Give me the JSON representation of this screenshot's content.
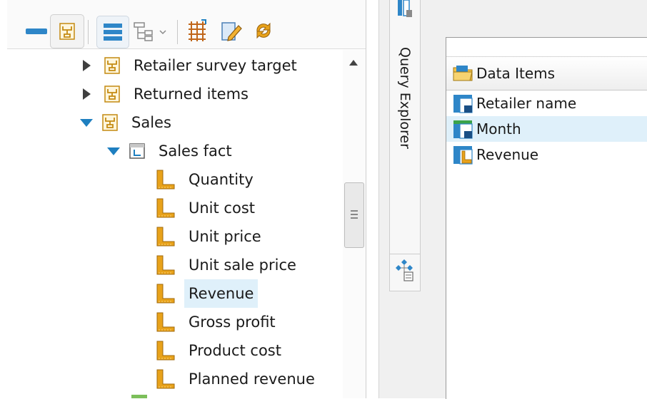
{
  "toolbar": {
    "buttons": [
      "collapse-all-icon",
      "package-view-icon",
      "list-view-icon",
      "tree-view-icon",
      "grid-icon",
      "edit-icon",
      "refresh-icon"
    ]
  },
  "tree": {
    "items": [
      {
        "label": "Retailer survey target",
        "state": "collapsed",
        "icon": "namespace-icon"
      },
      {
        "label": "Returned items",
        "state": "collapsed",
        "icon": "namespace-icon"
      },
      {
        "label": "Sales",
        "state": "expanded",
        "icon": "namespace-icon"
      },
      {
        "label": "Sales fact",
        "state": "expanded",
        "icon": "query-subject-icon"
      },
      {
        "label": "Quantity",
        "icon": "measure-icon"
      },
      {
        "label": "Unit cost",
        "icon": "measure-icon"
      },
      {
        "label": "Unit price",
        "icon": "measure-icon"
      },
      {
        "label": "Unit sale price",
        "icon": "measure-icon"
      },
      {
        "label": "Revenue",
        "icon": "measure-icon",
        "selected": true
      },
      {
        "label": "Gross profit",
        "icon": "measure-icon"
      },
      {
        "label": "Product cost",
        "icon": "measure-icon"
      },
      {
        "label": "Planned revenue",
        "icon": "measure-icon"
      }
    ]
  },
  "tab_strip": {
    "query_explorer_label": "Query Explorer"
  },
  "data_items": {
    "header": "Data Items",
    "items": [
      {
        "label": "Retailer name",
        "icon": "data-item-icon"
      },
      {
        "label": "Month",
        "icon": "data-item-icon",
        "selected": true
      },
      {
        "label": "Revenue",
        "icon": "measure-data-item-icon"
      }
    ]
  },
  "colors": {
    "accent": "#1e7fc0",
    "selection": "#dff0fa",
    "measure": "#e8a21a"
  }
}
